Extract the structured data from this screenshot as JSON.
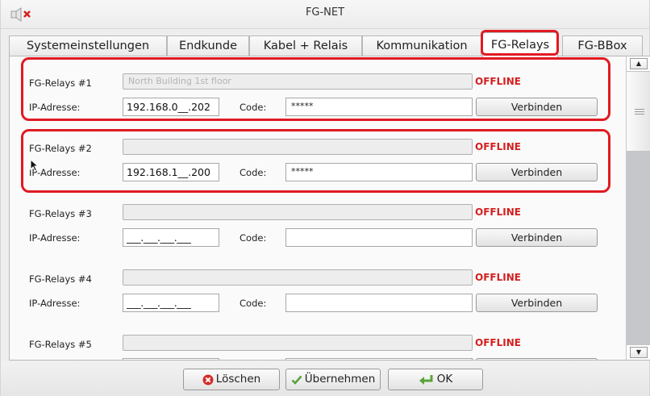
{
  "window": {
    "title": "FG-NET"
  },
  "tabs": [
    {
      "label": "Systemeinstellungen"
    },
    {
      "label": "Endkunde"
    },
    {
      "label": "Kabel + Relais"
    },
    {
      "label": "Kommunikation"
    },
    {
      "label": "FG-Relays",
      "active": true
    },
    {
      "label": "FG-BBox"
    }
  ],
  "relays": [
    {
      "label": "FG-Relays #1",
      "name_value": "North Building 1st floor",
      "status": "OFFLINE",
      "ip_label": "IP-Adresse:",
      "ip_value": "192.168.0__.202",
      "code_label": "Code:",
      "code_value": "*****",
      "connect_label": "Verbinden"
    },
    {
      "label": "FG-Relays #2",
      "name_value": "",
      "status": "OFFLINE",
      "ip_label": "IP-Adresse:",
      "ip_value": "192.168.1__.200",
      "code_label": "Code:",
      "code_value": "*****",
      "connect_label": "Verbinden"
    },
    {
      "label": "FG-Relays #3",
      "name_value": "",
      "status": "OFFLINE",
      "ip_label": "IP-Adresse:",
      "ip_value": "___.___.___.___",
      "code_label": "Code:",
      "code_value": "",
      "connect_label": "Verbinden"
    },
    {
      "label": "FG-Relays #4",
      "name_value": "",
      "status": "OFFLINE",
      "ip_label": "IP-Adresse:",
      "ip_value": "___.___.___.___",
      "code_label": "Code:",
      "code_value": "",
      "connect_label": "Verbinden"
    },
    {
      "label": "FG-Relays #5",
      "name_value": "",
      "status": "OFFLINE"
    }
  ],
  "footer": {
    "delete_label": "Löschen",
    "apply_label": "Übernehmen",
    "ok_label": "OK"
  },
  "colors": {
    "status_offline": "#d42020",
    "highlight": "#e01a22"
  },
  "icons": [
    "speaker-mute-icon",
    "delete-icon",
    "checkmark-icon",
    "enter-arrow-icon",
    "scroll-up-icon",
    "scroll-down-icon",
    "mouse-cursor-icon"
  ]
}
